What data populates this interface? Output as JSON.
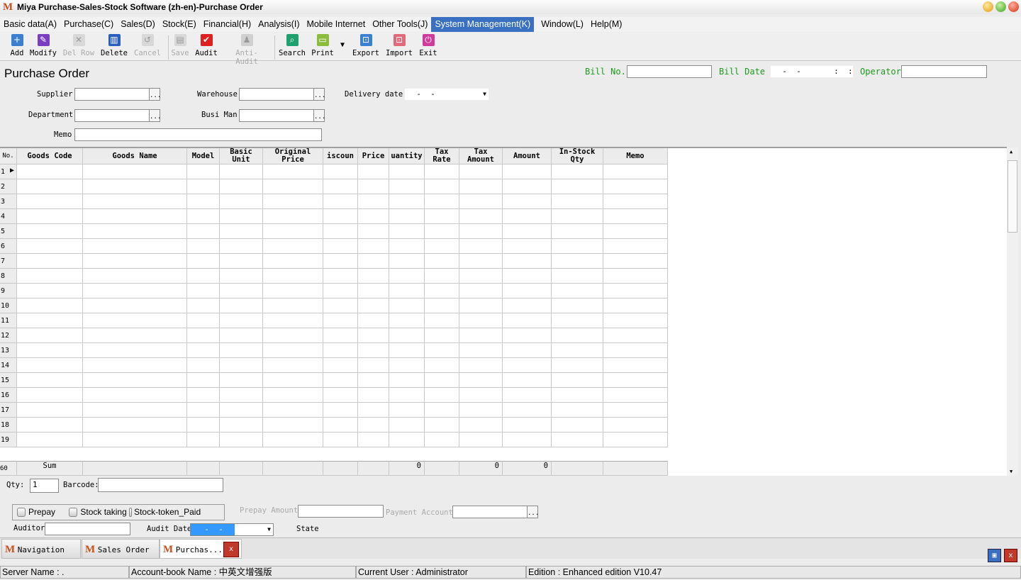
{
  "window": {
    "title": "Miya Purchase-Sales-Stock Software (zh-en)-Purchase Order"
  },
  "menu": [
    "Basic data(A)",
    "Purchase(C)",
    "Sales(D)",
    "Stock(E)",
    "Financial(H)",
    "Analysis(I)",
    "Mobile Internet",
    "Other Tools(J)",
    "System Management(K)",
    "Window(L)",
    "Help(M)"
  ],
  "menu_active": "System Management(K)",
  "toolbar": [
    {
      "label": "Add",
      "icon": "plus-icon",
      "color": "#3a7fd0",
      "glyph": "+",
      "enabled": true
    },
    {
      "label": "Modify",
      "icon": "edit-icon",
      "color": "#7a3fc0",
      "glyph": "✎",
      "enabled": true
    },
    {
      "label": "Del Row",
      "icon": "delete-row-icon",
      "color": "#d8d8d8",
      "glyph": "✕",
      "enabled": false
    },
    {
      "label": "Delete",
      "icon": "trash-icon",
      "color": "#2a5fc0",
      "glyph": "▥",
      "enabled": true
    },
    {
      "label": "Cancel",
      "icon": "undo-icon",
      "color": "#d8d8d8",
      "glyph": "↺",
      "enabled": false
    },
    {
      "label": "Save",
      "icon": "save-icon",
      "color": "#d8d8d8",
      "glyph": "▤",
      "enabled": false
    },
    {
      "label": "Audit",
      "icon": "check-icon",
      "color": "#e02020",
      "glyph": "✔",
      "enabled": true
    },
    {
      "label": "Anti-Audit",
      "icon": "users-icon",
      "color": "#d0d0d0",
      "glyph": "♟",
      "enabled": false
    },
    {
      "label": "Search",
      "icon": "search-icon",
      "color": "#20a070",
      "glyph": "⌕",
      "enabled": true
    },
    {
      "label": "Print",
      "icon": "printer-icon",
      "color": "#8cbc3c",
      "glyph": "▭",
      "enabled": true
    },
    {
      "label": "Export",
      "icon": "export-icon",
      "color": "#3a7fd0",
      "glyph": "⊡",
      "enabled": true
    },
    {
      "label": "Import",
      "icon": "import-icon",
      "color": "#e06a7a",
      "glyph": "⊡",
      "enabled": true
    },
    {
      "label": "Exit",
      "icon": "power-icon",
      "color": "#d03a9a",
      "glyph": "⏻",
      "enabled": true
    }
  ],
  "form": {
    "title": "Purchase Order",
    "bill_no_label": "Bill No.",
    "bill_no": "",
    "bill_date_label": "Bill Date",
    "bill_date": "  -  -       :  :",
    "operator_label": "Operator",
    "operator": "",
    "supplier_label": "Supplier",
    "warehouse_label": "Warehouse",
    "delivery_label": "Delivery date",
    "delivery_date": "  -  -",
    "department_label": "Department",
    "busiman_label": "Busi Man",
    "memo_label": "Memo"
  },
  "grid": {
    "columns": [
      "No.",
      "Goods Code",
      "Goods Name",
      "Model",
      "Basic Unit",
      "Original Price",
      "iscoun",
      "Price",
      "uantity",
      "Tax Rate",
      "Tax Amount",
      "Amount",
      "In-Stock Qty",
      "Memo"
    ],
    "rows": [
      "1",
      "2",
      "3",
      "4",
      "5",
      "6",
      "7",
      "8",
      "9",
      "10",
      "11",
      "12",
      "13",
      "14",
      "15",
      "16",
      "17",
      "18",
      "19"
    ],
    "sum_row": {
      "no": "60",
      "label": "Sum",
      "quantity": "0",
      "tax_amount": "0",
      "amount": "0"
    }
  },
  "bottom": {
    "qty_label": "Qty:",
    "qty": "1",
    "barcode_label": "Barcode:",
    "barcode": "",
    "prepay": "Prepay",
    "stock_taking": "Stock taking",
    "stock_token": "Stock-token_Paid",
    "prepay_amount_label": "Prepay Amount",
    "payment_account_label": "Payment Account",
    "auditor_label": "Auditor",
    "audit_date_label": "Audit Date",
    "audit_date": "  -  -",
    "state_label": "State"
  },
  "tabs": [
    "Navigation ...",
    "Sales Order",
    "Purchas..."
  ],
  "status": {
    "server": "Server Name : .",
    "account": "Account-book Name : 中英文增强版",
    "user": "Current User : Administrator",
    "edition": "Edition : Enhanced edition V10.47"
  }
}
